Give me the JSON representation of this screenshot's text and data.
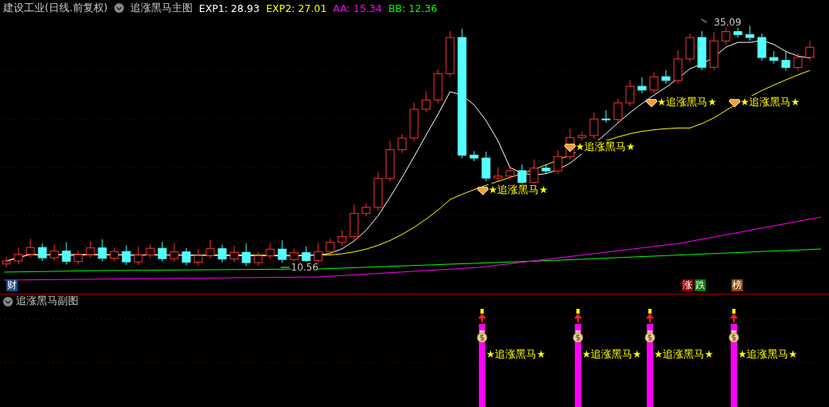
{
  "header": {
    "stock": "建设工业(日线.前复权)",
    "indicator": "追涨黑马主图",
    "values": [
      {
        "label": "EXP1: 28.93",
        "color": "#ffffff"
      },
      {
        "label": "EXP2: 27.01",
        "color": "#ffff00"
      },
      {
        "label": "AA: 15.34",
        "color": "#ff00ff"
      },
      {
        "label": "BB: 12.36",
        "color": "#00ff00"
      }
    ]
  },
  "main_chart": {
    "high_label": "35.09",
    "low_label": "10.56",
    "signals": [
      {
        "text": "★追涨黑马★"
      },
      {
        "text": "★追涨黑马★"
      },
      {
        "text": "★追涨黑马★"
      },
      {
        "text": "★追涨黑马★"
      }
    ],
    "badges": [
      {
        "text": "财",
        "color": "#1c4f86"
      },
      {
        "text": "涨",
        "color": "#8c0000"
      },
      {
        "text": "跌",
        "color": "#007800"
      },
      {
        "text": "榜",
        "color": "#8c4a10"
      }
    ]
  },
  "sub_chart": {
    "title": "追涨黑马副图",
    "signals": [
      {
        "text": "★追涨黑马★"
      },
      {
        "text": "★追涨黑马★"
      },
      {
        "text": "★追涨黑马★"
      },
      {
        "text": "★追涨黑马★"
      }
    ]
  }
}
